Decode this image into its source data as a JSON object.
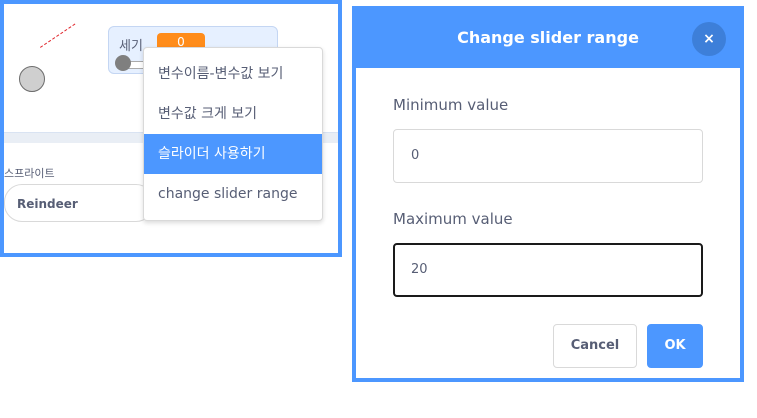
{
  "monitor": {
    "label": "세기",
    "value": "0"
  },
  "sprites": {
    "heading": "스프라이트",
    "current_name": "Reindeer"
  },
  "context_menu": {
    "items": [
      {
        "label": "변수이름-변수값 보기",
        "selected": false
      },
      {
        "label": "변수값 크게 보기",
        "selected": false
      },
      {
        "label": "슬라이더 사용하기",
        "selected": true
      },
      {
        "label": "change slider range",
        "selected": false
      }
    ]
  },
  "dialog": {
    "title": "Change slider range",
    "close_icon": "×",
    "min_label": "Minimum value",
    "min_value": "0",
    "max_label": "Maximum value",
    "max_value": "20",
    "cancel_label": "Cancel",
    "ok_label": "OK"
  },
  "colors": {
    "accent": "#4c97ff",
    "monitor_value": "#ff8c1a",
    "text": "#575e75"
  }
}
